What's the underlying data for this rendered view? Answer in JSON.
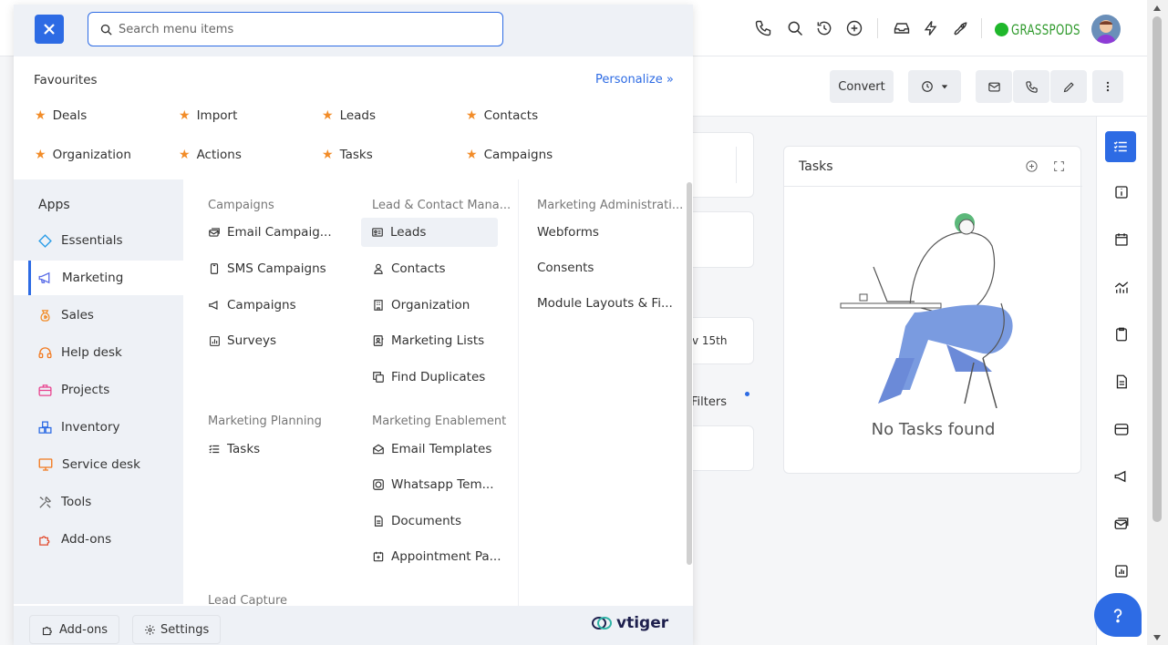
{
  "topbar": {
    "brand": "GRASSPODS"
  },
  "record_header": {
    "convert_label": "Convert"
  },
  "background": {
    "tasks_title": "Tasks",
    "no_tasks": "No Tasks found",
    "date_fragment": "v 15th",
    "filters_label": "Filters"
  },
  "search": {
    "placeholder": "Search menu items",
    "value": ""
  },
  "favourites": {
    "title": "Favourites",
    "personalize": "Personalize »",
    "items": [
      "Deals",
      "Import",
      "Leads",
      "Contacts",
      "Organization",
      "Actions",
      "Tasks",
      "Campaigns"
    ]
  },
  "apps": {
    "title": "Apps",
    "items": [
      "Essentials",
      "Marketing",
      "Sales",
      "Help desk",
      "Projects",
      "Inventory",
      "Service desk",
      "Tools",
      "Add-ons"
    ],
    "active": "Marketing"
  },
  "columns": {
    "campaigns": {
      "header": "Campaigns",
      "items": [
        "Email Campaig...",
        "SMS Campaigns",
        "Campaigns",
        "Surveys"
      ]
    },
    "marketing_planning": {
      "header": "Marketing Planning",
      "items": [
        "Tasks"
      ]
    },
    "lead_capture": {
      "header": "Lead Capture"
    },
    "lead_contact": {
      "header": "Lead & Contact Mana...",
      "items": [
        "Leads",
        "Contacts",
        "Organization",
        "Marketing Lists",
        "Find Duplicates"
      ]
    },
    "enablement": {
      "header": "Marketing Enablement",
      "items": [
        "Email Templates",
        "Whatsapp Tem...",
        "Documents",
        "Appointment Pa..."
      ]
    },
    "admin": {
      "header": "Marketing Administrati...",
      "items": [
        "Webforms",
        "Consents",
        "Module Layouts & Fi..."
      ]
    }
  },
  "footer": {
    "addons_label": "Add-ons",
    "settings_label": "Settings",
    "logo": "vtiger"
  },
  "colors": {
    "accent": "#2d6be4",
    "star": "#f28c28",
    "brand_green": "#2f9a2c"
  }
}
